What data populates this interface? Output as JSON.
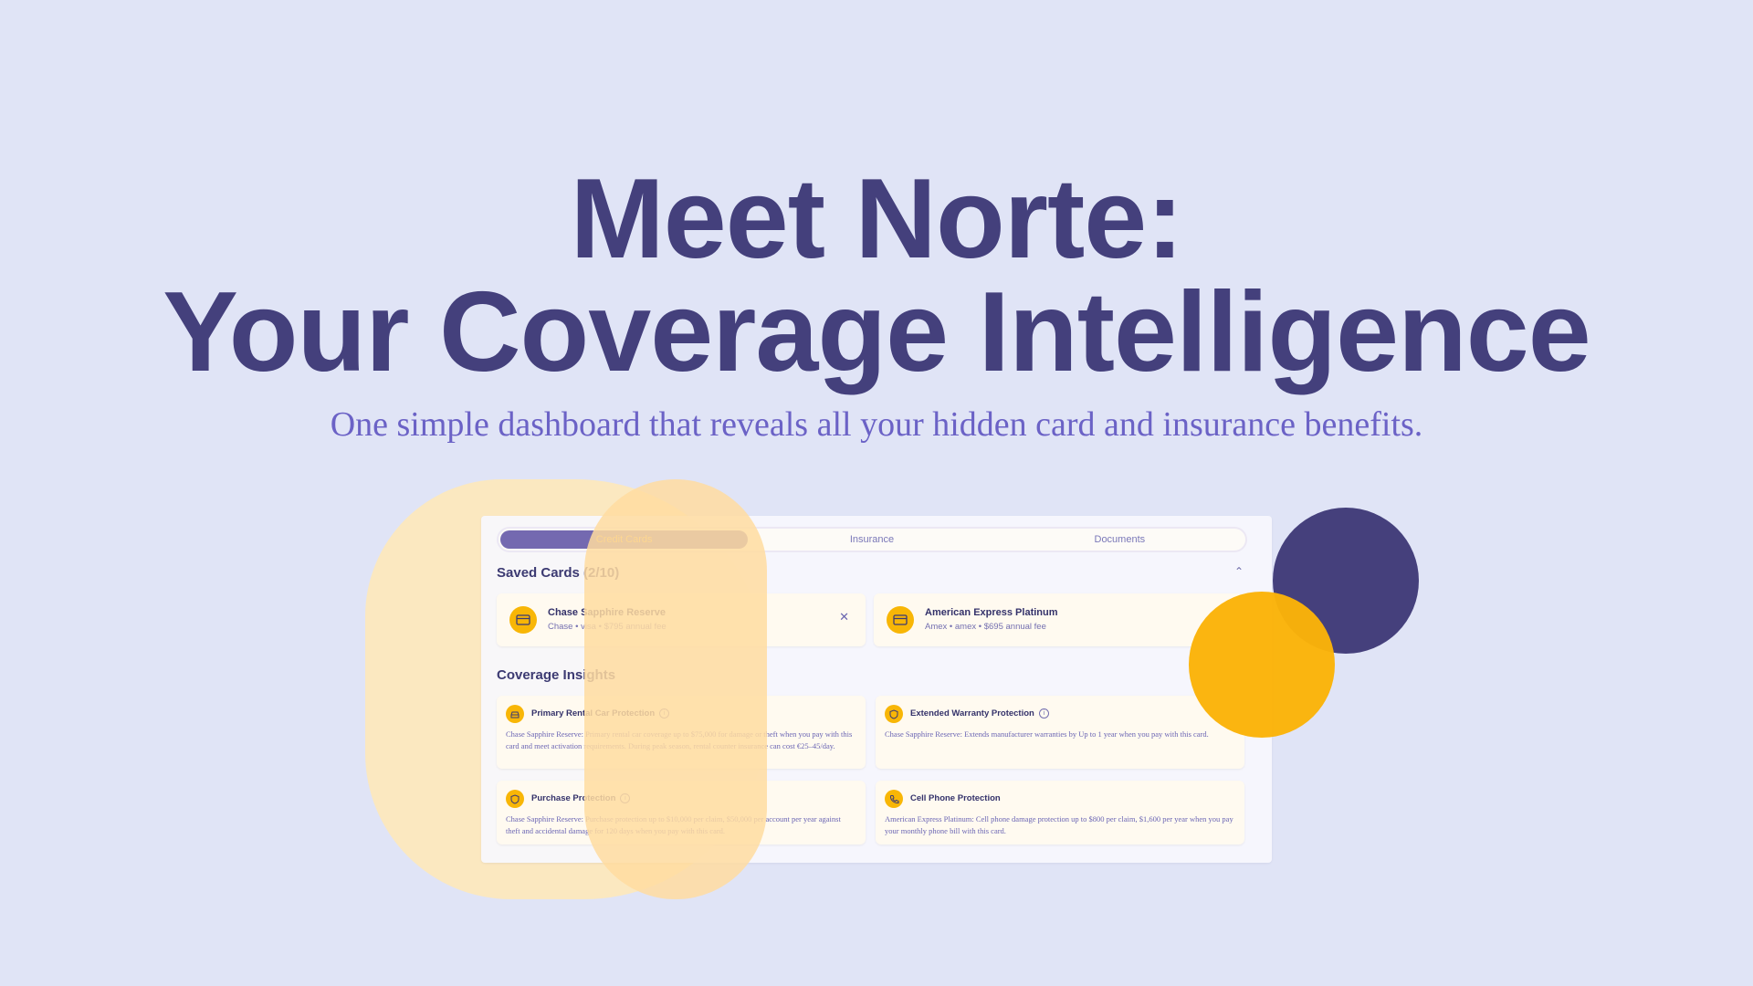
{
  "hero": {
    "title_line1": "Meet Norte:",
    "title_line2": "Your Coverage Intelligence",
    "subtitle": "One simple dashboard that reveals all your hidden card and insurance benefits."
  },
  "colors": {
    "background": "#e0e4f6",
    "title": "#44407c",
    "subtitle": "#6b62c6",
    "accent_gold": "#fbb308",
    "accent_navy": "#45407c",
    "tab_active": "#7469b0"
  },
  "dashboard": {
    "tabs": [
      {
        "label": "Credit Cards",
        "active": true
      },
      {
        "label": "Insurance",
        "active": false
      },
      {
        "label": "Documents",
        "active": false
      }
    ],
    "saved_cards_title": "Saved Cards (2/10)",
    "collapse_icon": "chevron-up-icon",
    "saved_cards": [
      {
        "name": "Chase Sapphire Reserve",
        "meta": "Chase • visa • $795 annual fee",
        "icon": "credit-card-icon",
        "removable": true
      },
      {
        "name": "American Express Platinum",
        "meta": "Amex • amex • $695 annual fee",
        "icon": "credit-card-icon",
        "removable": false
      }
    ],
    "insights_title": "Coverage Insights",
    "insights": [
      {
        "title": "Primary Rental Car Protection",
        "icon": "car-icon",
        "info": true,
        "body": "Chase Sapphire Reserve: Primary rental car coverage up to $75,000 for damage or theft when you pay with this card and meet activation requirements. During peak season, rental counter insurance can cost €25–45/day."
      },
      {
        "title": "Extended Warranty Protection",
        "icon": "shield-icon",
        "info": true,
        "body": "Chase Sapphire Reserve: Extends manufacturer warranties by Up to 1 year when you pay with this card."
      },
      {
        "title": "Purchase Protection",
        "icon": "shield-icon",
        "info": true,
        "body": "Chase Sapphire Reserve: Purchase protection up to $10,000 per claim, $50,000 per account per year against theft and accidental damage for 120 days when you pay with this card."
      },
      {
        "title": "Cell Phone Protection",
        "icon": "phone-icon",
        "info": false,
        "body": "American Express Platinum: Cell phone damage protection up to $800 per claim, $1,600 per year when you pay your monthly phone bill with this card."
      }
    ]
  }
}
